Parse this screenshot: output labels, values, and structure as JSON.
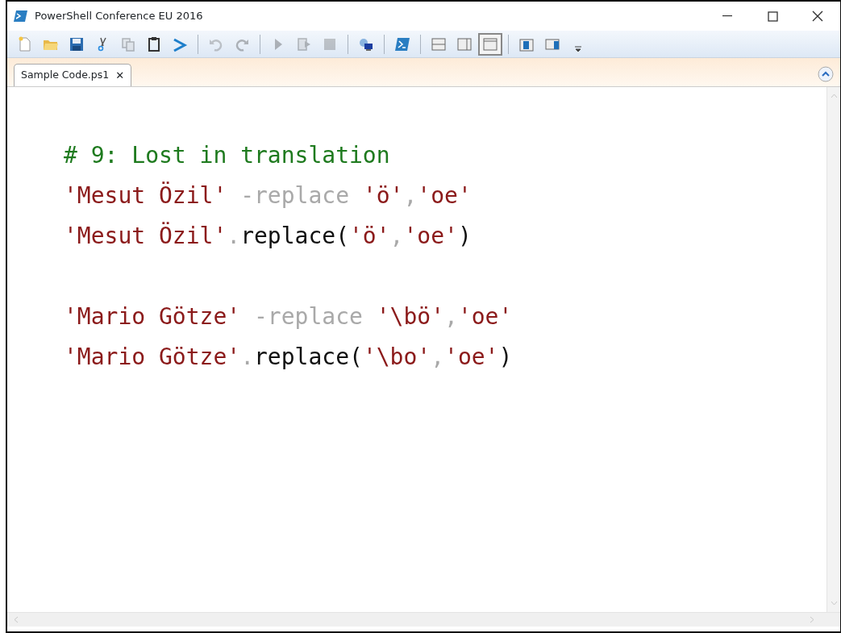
{
  "window": {
    "title": "PowerShell Conference EU 2016"
  },
  "toolbar": [
    {
      "kind": "button",
      "disabled": false,
      "selected": false
    },
    {
      "kind": "button",
      "disabled": false,
      "selected": false
    },
    {
      "kind": "button",
      "disabled": false,
      "selected": false
    },
    {
      "kind": "button",
      "disabled": false,
      "selected": false
    },
    {
      "kind": "button",
      "disabled": true,
      "selected": false
    },
    {
      "kind": "button",
      "disabled": false,
      "selected": false
    },
    {
      "kind": "button",
      "disabled": false,
      "selected": false
    },
    {
      "kind": "separator"
    },
    {
      "kind": "button",
      "disabled": true,
      "selected": false
    },
    {
      "kind": "button",
      "disabled": true,
      "selected": false
    },
    {
      "kind": "separator"
    },
    {
      "kind": "button",
      "disabled": true,
      "selected": false
    },
    {
      "kind": "button",
      "disabled": true,
      "selected": false
    },
    {
      "kind": "button",
      "disabled": true,
      "selected": false
    },
    {
      "kind": "separator"
    },
    {
      "kind": "button",
      "disabled": false,
      "selected": false
    },
    {
      "kind": "separator"
    },
    {
      "kind": "button",
      "disabled": false,
      "selected": false
    },
    {
      "kind": "separator"
    },
    {
      "kind": "button",
      "disabled": false,
      "selected": false
    },
    {
      "kind": "button",
      "disabled": false,
      "selected": false
    },
    {
      "kind": "button",
      "disabled": false,
      "selected": true
    },
    {
      "kind": "separator"
    },
    {
      "kind": "button",
      "disabled": false,
      "selected": false
    },
    {
      "kind": "button",
      "disabled": false,
      "selected": false
    },
    {
      "kind": "overflow"
    }
  ],
  "tabs": [
    {
      "label": "Sample Code.ps1",
      "close": "✕",
      "selected": true
    }
  ],
  "editor": {
    "lines": [
      {
        "kind": "code",
        "tokens": [
          {
            "kind": "comment",
            "text": "# 9: Lost in translation"
          }
        ]
      },
      {
        "kind": "code",
        "tokens": [
          {
            "kind": "string",
            "text": "'Mesut Özil'"
          },
          {
            "kind": "operator",
            "text": " -replace "
          },
          {
            "kind": "string",
            "text": "'ö'"
          },
          {
            "kind": "operator",
            "text": ","
          },
          {
            "kind": "string",
            "text": "'oe'"
          }
        ]
      },
      {
        "kind": "code",
        "tokens": [
          {
            "kind": "string",
            "text": "'Mesut Özil'"
          },
          {
            "kind": "operator",
            "text": "."
          },
          {
            "kind": "plain",
            "text": "replace("
          },
          {
            "kind": "string",
            "text": "'ö'"
          },
          {
            "kind": "operator",
            "text": ","
          },
          {
            "kind": "string",
            "text": "'oe'"
          },
          {
            "kind": "plain",
            "text": ")"
          }
        ]
      },
      {
        "kind": "blank"
      },
      {
        "kind": "code",
        "tokens": [
          {
            "kind": "string",
            "text": "'Mario Götze'"
          },
          {
            "kind": "operator",
            "text": " -replace "
          },
          {
            "kind": "string",
            "text": "'\\bö'"
          },
          {
            "kind": "operator",
            "text": ","
          },
          {
            "kind": "string",
            "text": "'oe'"
          }
        ]
      },
      {
        "kind": "code",
        "tokens": [
          {
            "kind": "string",
            "text": "'Mario Götze'"
          },
          {
            "kind": "operator",
            "text": "."
          },
          {
            "kind": "plain",
            "text": "replace("
          },
          {
            "kind": "string",
            "text": "'\\bo'"
          },
          {
            "kind": "operator",
            "text": ","
          },
          {
            "kind": "string",
            "text": "'oe'"
          },
          {
            "kind": "plain",
            "text": ")"
          }
        ]
      }
    ]
  }
}
